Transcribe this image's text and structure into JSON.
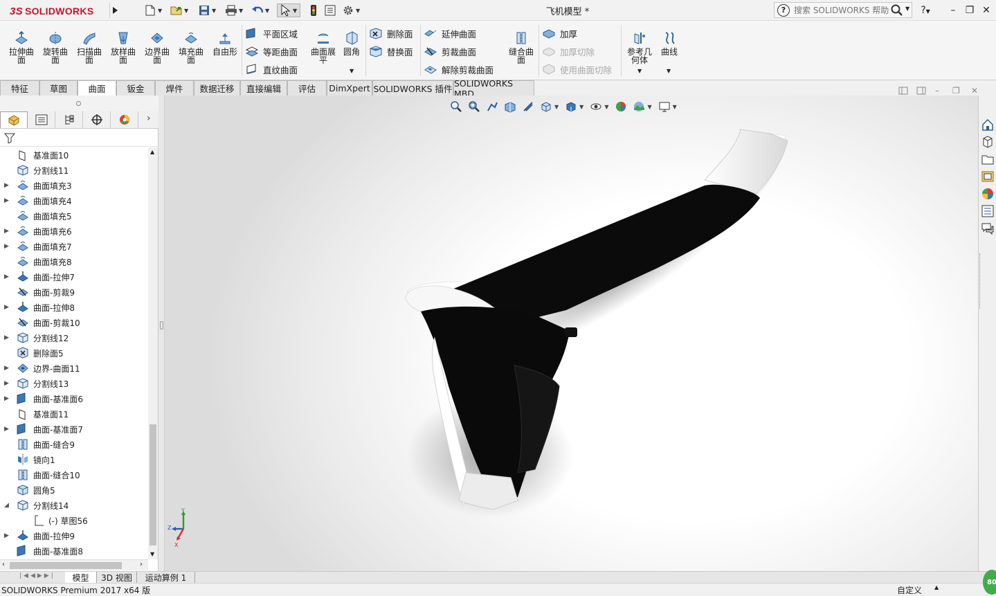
{
  "app": {
    "brand_prefix": "3S",
    "brand_name": "SOLIDWORKS",
    "document_title": "飞机模型 *"
  },
  "help_search": {
    "placeholder": "搜索 SOLIDWORKS 帮助"
  },
  "title_controls": {
    "help": "?",
    "minimize": "–",
    "restore": "❐",
    "close": "✕"
  },
  "ribbon": {
    "big_buttons": [
      {
        "label": "拉伸曲面",
        "icon": "extruded-surface-icon"
      },
      {
        "label": "旋转曲面",
        "icon": "revolved-surface-icon"
      },
      {
        "label": "扫描曲面",
        "icon": "swept-surface-icon"
      },
      {
        "label": "放样曲面",
        "icon": "lofted-surface-icon"
      },
      {
        "label": "边界曲面",
        "icon": "boundary-surface-icon"
      },
      {
        "label": "填充曲面",
        "icon": "filled-surface-icon"
      },
      {
        "label": "自由形",
        "icon": "freeform-icon"
      }
    ],
    "group2": [
      {
        "label": "平面区域",
        "icon": "planar-surface-icon"
      },
      {
        "label": "等距曲面",
        "icon": "offset-surface-icon"
      },
      {
        "label": "直纹曲面",
        "icon": "ruled-surface-icon"
      }
    ],
    "flatten": {
      "label": "曲面展平",
      "icon": "surface-flatten-icon"
    },
    "fillet": {
      "label": "圆角",
      "icon": "fillet-icon"
    },
    "group3": [
      {
        "label": "删除面",
        "icon": "delete-face-icon"
      },
      {
        "label": "替换面",
        "icon": "replace-face-icon"
      }
    ],
    "group4": [
      {
        "label": "延伸曲面",
        "icon": "extend-surface-icon"
      },
      {
        "label": "剪裁曲面",
        "icon": "trim-surface-icon"
      },
      {
        "label": "解除剪裁曲面",
        "icon": "untrim-surface-icon"
      }
    ],
    "knit": {
      "label": "缝合曲面",
      "icon": "knit-surface-icon"
    },
    "group5": [
      {
        "label": "加厚",
        "icon": "thicken-icon",
        "enabled": true
      },
      {
        "label": "加厚切除",
        "icon": "thicken-cut-icon",
        "enabled": false
      },
      {
        "label": "使用曲面切除",
        "icon": "surface-cut-icon",
        "enabled": false
      }
    ],
    "ref_geometry": {
      "label": "参考几何体",
      "icon": "reference-geometry-icon"
    },
    "curves": {
      "label": "曲线",
      "icon": "curves-icon"
    }
  },
  "tabs": [
    {
      "label": "特征",
      "active": false
    },
    {
      "label": "草图",
      "active": false
    },
    {
      "label": "曲面",
      "active": true
    },
    {
      "label": "钣金",
      "active": false
    },
    {
      "label": "焊件",
      "active": false
    },
    {
      "label": "数据迁移",
      "active": false
    },
    {
      "label": "直接编辑",
      "active": false
    },
    {
      "label": "评估",
      "active": false
    },
    {
      "label": "DimXpert",
      "active": false
    },
    {
      "label": "SOLIDWORKS 插件",
      "active": false
    },
    {
      "label": "SOLIDWORKS MBD",
      "active": false
    }
  ],
  "panel_tabs": [
    {
      "icon": "feature-manager-icon",
      "active": true
    },
    {
      "icon": "property-manager-icon",
      "active": false
    },
    {
      "icon": "configuration-manager-icon",
      "active": false
    },
    {
      "icon": "dimxpert-manager-icon",
      "active": false
    },
    {
      "icon": "display-manager-icon",
      "active": false
    }
  ],
  "tree": [
    {
      "label": "基准面10",
      "icon": "plane-icon",
      "expandable": false
    },
    {
      "label": "分割线11",
      "icon": "split-line-icon",
      "expandable": false
    },
    {
      "label": "曲面填充3",
      "icon": "filled-surface-icon",
      "expandable": true
    },
    {
      "label": "曲面填充4",
      "icon": "filled-surface-icon",
      "expandable": true
    },
    {
      "label": "曲面填充5",
      "icon": "filled-surface-icon",
      "expandable": false
    },
    {
      "label": "曲面填充6",
      "icon": "filled-surface-icon",
      "expandable": true
    },
    {
      "label": "曲面填充7",
      "icon": "filled-surface-icon",
      "expandable": true
    },
    {
      "label": "曲面填充8",
      "icon": "filled-surface-icon",
      "expandable": false
    },
    {
      "label": "曲面-拉伸7",
      "icon": "extruded-surface-icon",
      "expandable": true
    },
    {
      "label": "曲面-剪裁9",
      "icon": "trim-surface-icon",
      "expandable": false
    },
    {
      "label": "曲面-拉伸8",
      "icon": "extruded-surface-icon",
      "expandable": true
    },
    {
      "label": "曲面-剪裁10",
      "icon": "trim-surface-icon",
      "expandable": false
    },
    {
      "label": "分割线12",
      "icon": "split-line-icon",
      "expandable": true
    },
    {
      "label": "删除面5",
      "icon": "delete-face-icon",
      "expandable": false
    },
    {
      "label": "边界-曲面11",
      "icon": "boundary-surface-icon",
      "expandable": true
    },
    {
      "label": "分割线13",
      "icon": "split-line-icon",
      "expandable": true
    },
    {
      "label": "曲面-基准面6",
      "icon": "planar-surface-icon",
      "expandable": true
    },
    {
      "label": "基准面11",
      "icon": "plane-icon",
      "expandable": false
    },
    {
      "label": "曲面-基准面7",
      "icon": "planar-surface-icon",
      "expandable": true
    },
    {
      "label": "曲面-缝合9",
      "icon": "knit-surface-icon",
      "expandable": false
    },
    {
      "label": "镜向1",
      "icon": "mirror-icon",
      "expandable": false
    },
    {
      "label": "曲面-缝合10",
      "icon": "knit-surface-icon",
      "expandable": false
    },
    {
      "label": "圆角5",
      "icon": "fillet-icon",
      "expandable": false
    },
    {
      "label": "分割线14",
      "icon": "split-line-icon",
      "expandable": true,
      "expanded": true
    },
    {
      "label": "(-) 草图56",
      "icon": "sketch-icon",
      "expandable": false,
      "child": true
    },
    {
      "label": "曲面-拉伸9",
      "icon": "extruded-surface-icon",
      "expandable": true
    },
    {
      "label": "曲面-基准面8",
      "icon": "planar-surface-icon",
      "expandable": false
    }
  ],
  "triad": {
    "y": "Y",
    "z": "Z",
    "x": "X"
  },
  "model_tabs": [
    {
      "label": "模型",
      "active": true
    },
    {
      "label": "3D 视图",
      "active": false
    },
    {
      "label": "运动算例 1",
      "active": false
    }
  ],
  "status": {
    "left": "SOLIDWORKS Premium 2017 x64 版",
    "right": "自定义",
    "badge": "80"
  },
  "colors": {
    "brand": "#c8102e",
    "icon_blue": "#3a78b5",
    "wing_dark": "#0b0b0b"
  }
}
